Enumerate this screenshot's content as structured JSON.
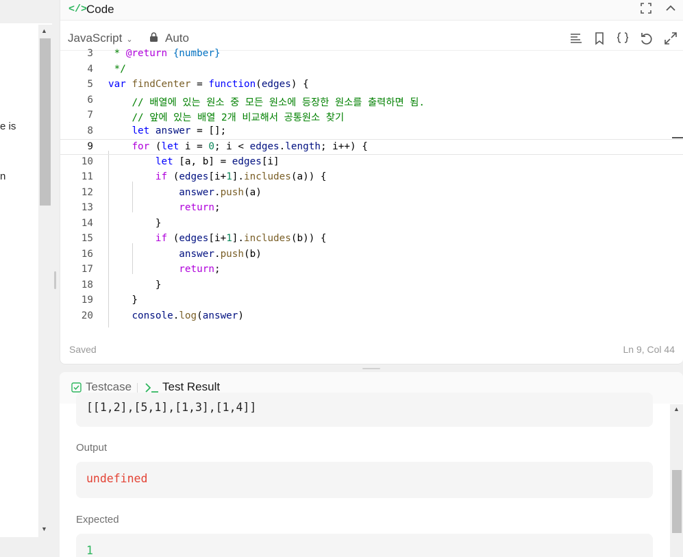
{
  "left_panel": {
    "fragments": [
      "e is",
      "n"
    ]
  },
  "code_panel": {
    "header_icon": "</>",
    "title": "Code",
    "header_buttons": [
      "fullscreen-icon",
      "collapse-up-icon"
    ],
    "language": "JavaScript",
    "mode": "Auto",
    "toolbar_icons": [
      "format-lines-icon",
      "bookmark-icon",
      "braces-icon",
      "reset-icon",
      "expand-icon"
    ],
    "status_saved": "Saved",
    "cursor_position": "Ln 9, Col 44",
    "active_line": 9
  },
  "code_lines": [
    {
      "n": "3",
      "text": " * @return {number}"
    },
    {
      "n": "4",
      "text": " */"
    },
    {
      "n": "5",
      "text": "var findCenter = function(edges) {"
    },
    {
      "n": "6",
      "text": "    // 배열에 있는 원소 중 모든 원소에 등장한 원소를 출력하면 됨."
    },
    {
      "n": "7",
      "text": "    // 앞에 있는 배열 2개 비교해서 공통원소 찾기"
    },
    {
      "n": "8",
      "text": "    let answer = [];"
    },
    {
      "n": "9",
      "text": "    for (let i = 0; i < edges.length; i++) {"
    },
    {
      "n": "10",
      "text": "        let [a, b] = edges[i]"
    },
    {
      "n": "11",
      "text": "        if (edges[i+1].includes(a)) {"
    },
    {
      "n": "12",
      "text": "            answer.push(a)"
    },
    {
      "n": "13",
      "text": "            return;"
    },
    {
      "n": "14",
      "text": "        }"
    },
    {
      "n": "15",
      "text": "        if (edges[i+1].includes(b)) {"
    },
    {
      "n": "16",
      "text": "            answer.push(b)"
    },
    {
      "n": "17",
      "text": "            return;"
    },
    {
      "n": "18",
      "text": "        }"
    },
    {
      "n": "19",
      "text": "    }"
    },
    {
      "n": "20",
      "text": "    console.log(answer)"
    }
  ],
  "result_panel": {
    "tab_testcase": "Testcase",
    "tab_result": "Test Result",
    "input_value": "[[1,2],[5,1],[1,3],[1,4]]",
    "output_label": "Output",
    "output_value": "undefined",
    "expected_label": "Expected",
    "expected_value": "1"
  },
  "colors": {
    "accent_green": "#2db55d",
    "error_red": "#e34234",
    "expected_green": "#2db55d"
  }
}
